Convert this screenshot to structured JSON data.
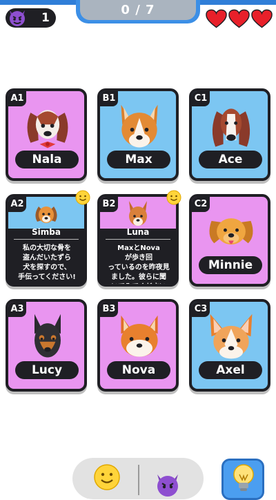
{
  "header": {
    "devil_count": "1",
    "progress": "0 / 7",
    "lives": 3,
    "heart_color": "#e8202a"
  },
  "cards": {
    "a1": {
      "tag": "A1",
      "name": "Nala",
      "bg": "pink"
    },
    "b1": {
      "tag": "B1",
      "name": "Max",
      "bg": "blue"
    },
    "c1": {
      "tag": "C1",
      "name": "Ace",
      "bg": "blue"
    },
    "a2": {
      "tag": "A2",
      "name": "Simba",
      "text": "私の大切な骨を\n盗んだいたずら\n犬を探すので、\n手伝ってください!"
    },
    "b2": {
      "tag": "B2",
      "name": "Luna",
      "text": "MaxとNova\nが歩き回\nっているのを昨夜見\nました。彼らに聞\nいてみてください"
    },
    "c2": {
      "tag": "C2",
      "name": "Minnie",
      "bg": "pink"
    },
    "a3": {
      "tag": "A3",
      "name": "Lucy",
      "bg": "pink"
    },
    "b3": {
      "tag": "B3",
      "name": "Nova",
      "bg": "pink"
    },
    "c3": {
      "tag": "C3",
      "name": "Axel",
      "bg": "blue"
    }
  },
  "footer": {
    "buttons": [
      "smiley-icon",
      "devil-icon",
      "lightbulb-icon"
    ]
  }
}
